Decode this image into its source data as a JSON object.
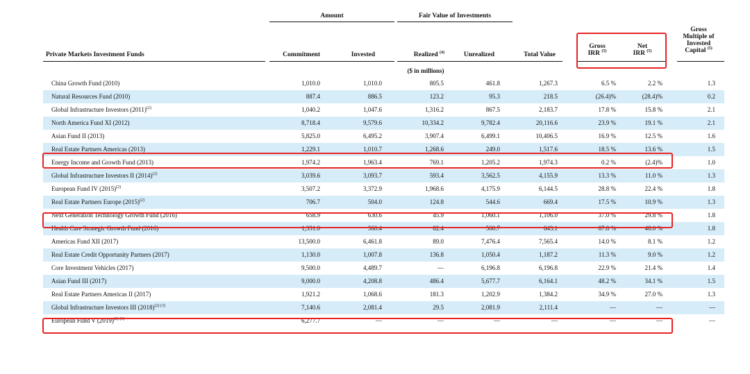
{
  "column_groups": {
    "amount": "Amount",
    "fair_value": "Fair Value of Investments"
  },
  "headers": {
    "fund": "Private Markets Investment Funds",
    "commitment": "Commitment",
    "invested": "Invested",
    "realized": "Realized",
    "realized_note": "(4)",
    "unrealized": "Unrealized",
    "total_value": "Total Value",
    "gross_irr_1": "Gross",
    "gross_irr_2": "IRR",
    "gross_irr_note": "(5)",
    "net_irr_1": "Net",
    "net_irr_2": "IRR",
    "net_irr_note": "(5)",
    "moic_1": "Gross",
    "moic_2": "Multiple of",
    "moic_3": "Invested",
    "moic_4": "Capital",
    "moic_note": "(5)"
  },
  "units_label": "($ in millions)",
  "highlight_color": "#e62222",
  "shade_color": "#d6ecf8",
  "rows": [
    {
      "name": "China Growth Fund (2010)",
      "note": "",
      "commitment": "1,010.0",
      "invested": "1,010.0",
      "realized": "805.5",
      "unrealized": "461.8",
      "total": "1,267.3",
      "gross_irr": "6.5 %",
      "net_irr": "2.2 %",
      "moic": "1.3"
    },
    {
      "name": "Natural Resources Fund (2010)",
      "note": "",
      "commitment": "887.4",
      "invested": "886.5",
      "realized": "123.2",
      "unrealized": "95.3",
      "total": "218.5",
      "gross_irr": "(26.4)%",
      "net_irr": "(28.4)%",
      "moic": "0.2"
    },
    {
      "name": "Global Infrastructure Investors (2011)",
      "note": "(2)",
      "commitment": "1,040.2",
      "invested": "1,047.6",
      "realized": "1,316.2",
      "unrealized": "867.5",
      "total": "2,183.7",
      "gross_irr": "17.8 %",
      "net_irr": "15.8 %",
      "moic": "2.1"
    },
    {
      "name": "North America Fund XI (2012)",
      "note": "",
      "commitment": "8,718.4",
      "invested": "9,579.6",
      "realized": "10,334.2",
      "unrealized": "9,782.4",
      "total": "20,116.6",
      "gross_irr": "23.9 %",
      "net_irr": "19.1 %",
      "moic": "2.1"
    },
    {
      "name": "Asian Fund II (2013)",
      "note": "",
      "commitment": "5,825.0",
      "invested": "6,495.2",
      "realized": "3,907.4",
      "unrealized": "6,499.1",
      "total": "10,406.5",
      "gross_irr": "16.9 %",
      "net_irr": "12.5 %",
      "moic": "1.6"
    },
    {
      "name": "Real Estate Partners Americas (2013)",
      "note": "",
      "commitment": "1,229.1",
      "invested": "1,010.7",
      "realized": "1,268.6",
      "unrealized": "249.0",
      "total": "1,517.6",
      "gross_irr": "18.5 %",
      "net_irr": "13.6 %",
      "moic": "1.5"
    },
    {
      "name": "Energy Income and Growth Fund (2013)",
      "note": "",
      "commitment": "1,974.2",
      "invested": "1,963.4",
      "realized": "769.1",
      "unrealized": "1,205.2",
      "total": "1,974.3",
      "gross_irr": "0.2 %",
      "net_irr": "(2.4)%",
      "moic": "1.0"
    },
    {
      "name": "Global Infrastructure Investors II (2014)",
      "note": "(2)",
      "commitment": "3,039.6",
      "invested": "3,093.7",
      "realized": "593.4",
      "unrealized": "3,562.5",
      "total": "4,155.9",
      "gross_irr": "13.3 %",
      "net_irr": "11.0 %",
      "moic": "1.3"
    },
    {
      "name": "European Fund IV (2015)",
      "note": "(2)",
      "commitment": "3,507.2",
      "invested": "3,372.9",
      "realized": "1,968.6",
      "unrealized": "4,175.9",
      "total": "6,144.5",
      "gross_irr": "28.8 %",
      "net_irr": "22.4 %",
      "moic": "1.8"
    },
    {
      "name": "Real Estate Partners Europe (2015)",
      "note": "(2)",
      "commitment": "706.7",
      "invested": "504.0",
      "realized": "124.8",
      "unrealized": "544.6",
      "total": "669.4",
      "gross_irr": "17.5 %",
      "net_irr": "10.9 %",
      "moic": "1.3"
    },
    {
      "name": "Next Generation Technology Growth Fund (2016)",
      "note": "",
      "commitment": "658.9",
      "invested": "630.6",
      "realized": "45.9",
      "unrealized": "1,060.1",
      "total": "1,106.0",
      "gross_irr": "37.0 %",
      "net_irr": "29.8 %",
      "moic": "1.8"
    },
    {
      "name": "Health Care Strategic Growth Fund (2016)",
      "note": "",
      "commitment": "1,331.0",
      "invested": "360.4",
      "realized": "82.4",
      "unrealized": "560.7",
      "total": "643.1",
      "gross_irr": "87.8 %",
      "net_irr": "48.0 %",
      "moic": "1.8"
    },
    {
      "name": "Americas Fund XII (2017)",
      "note": "",
      "commitment": "13,500.0",
      "invested": "6,461.8",
      "realized": "89.0",
      "unrealized": "7,476.4",
      "total": "7,565.4",
      "gross_irr": "14.0 %",
      "net_irr": "8.1 %",
      "moic": "1.2"
    },
    {
      "name": "Real Estate Credit Opportunity Partners (2017)",
      "note": "",
      "commitment": "1,130.0",
      "invested": "1,007.8",
      "realized": "136.8",
      "unrealized": "1,050.4",
      "total": "1,187.2",
      "gross_irr": "11.3 %",
      "net_irr": "9.0 %",
      "moic": "1.2"
    },
    {
      "name": "Core Investment Vehicles (2017)",
      "note": "",
      "commitment": "9,500.0",
      "invested": "4,489.7",
      "realized": "—",
      "unrealized": "6,196.8",
      "total": "6,196.8",
      "gross_irr": "22.9 %",
      "net_irr": "21.4 %",
      "moic": "1.4"
    },
    {
      "name": "Asian Fund III (2017)",
      "note": "",
      "commitment": "9,000.0",
      "invested": "4,208.8",
      "realized": "486.4",
      "unrealized": "5,677.7",
      "total": "6,164.1",
      "gross_irr": "48.2 %",
      "net_irr": "34.1 %",
      "moic": "1.5"
    },
    {
      "name": "Real Estate Partners Americas II (2017)",
      "note": "",
      "commitment": "1,921.2",
      "invested": "1,068.6",
      "realized": "181.3",
      "unrealized": "1,202.9",
      "total": "1,384.2",
      "gross_irr": "34.9 %",
      "net_irr": "27.0 %",
      "moic": "1.3"
    },
    {
      "name": "Global Infrastructure Investors III (2018)",
      "note": "(2) (3)",
      "commitment": "7,140.6",
      "invested": "2,081.4",
      "realized": "29.5",
      "unrealized": "2,081.9",
      "total": "2,111.4",
      "gross_irr": "—",
      "net_irr": "—",
      "moic": "—"
    },
    {
      "name": "European Fund V (2019)",
      "note": "(2) (3)",
      "commitment": "6,277.7",
      "invested": "—",
      "realized": "—",
      "unrealized": "—",
      "total": "—",
      "gross_irr": "—",
      "net_irr": "—",
      "moic": "—"
    }
  ]
}
